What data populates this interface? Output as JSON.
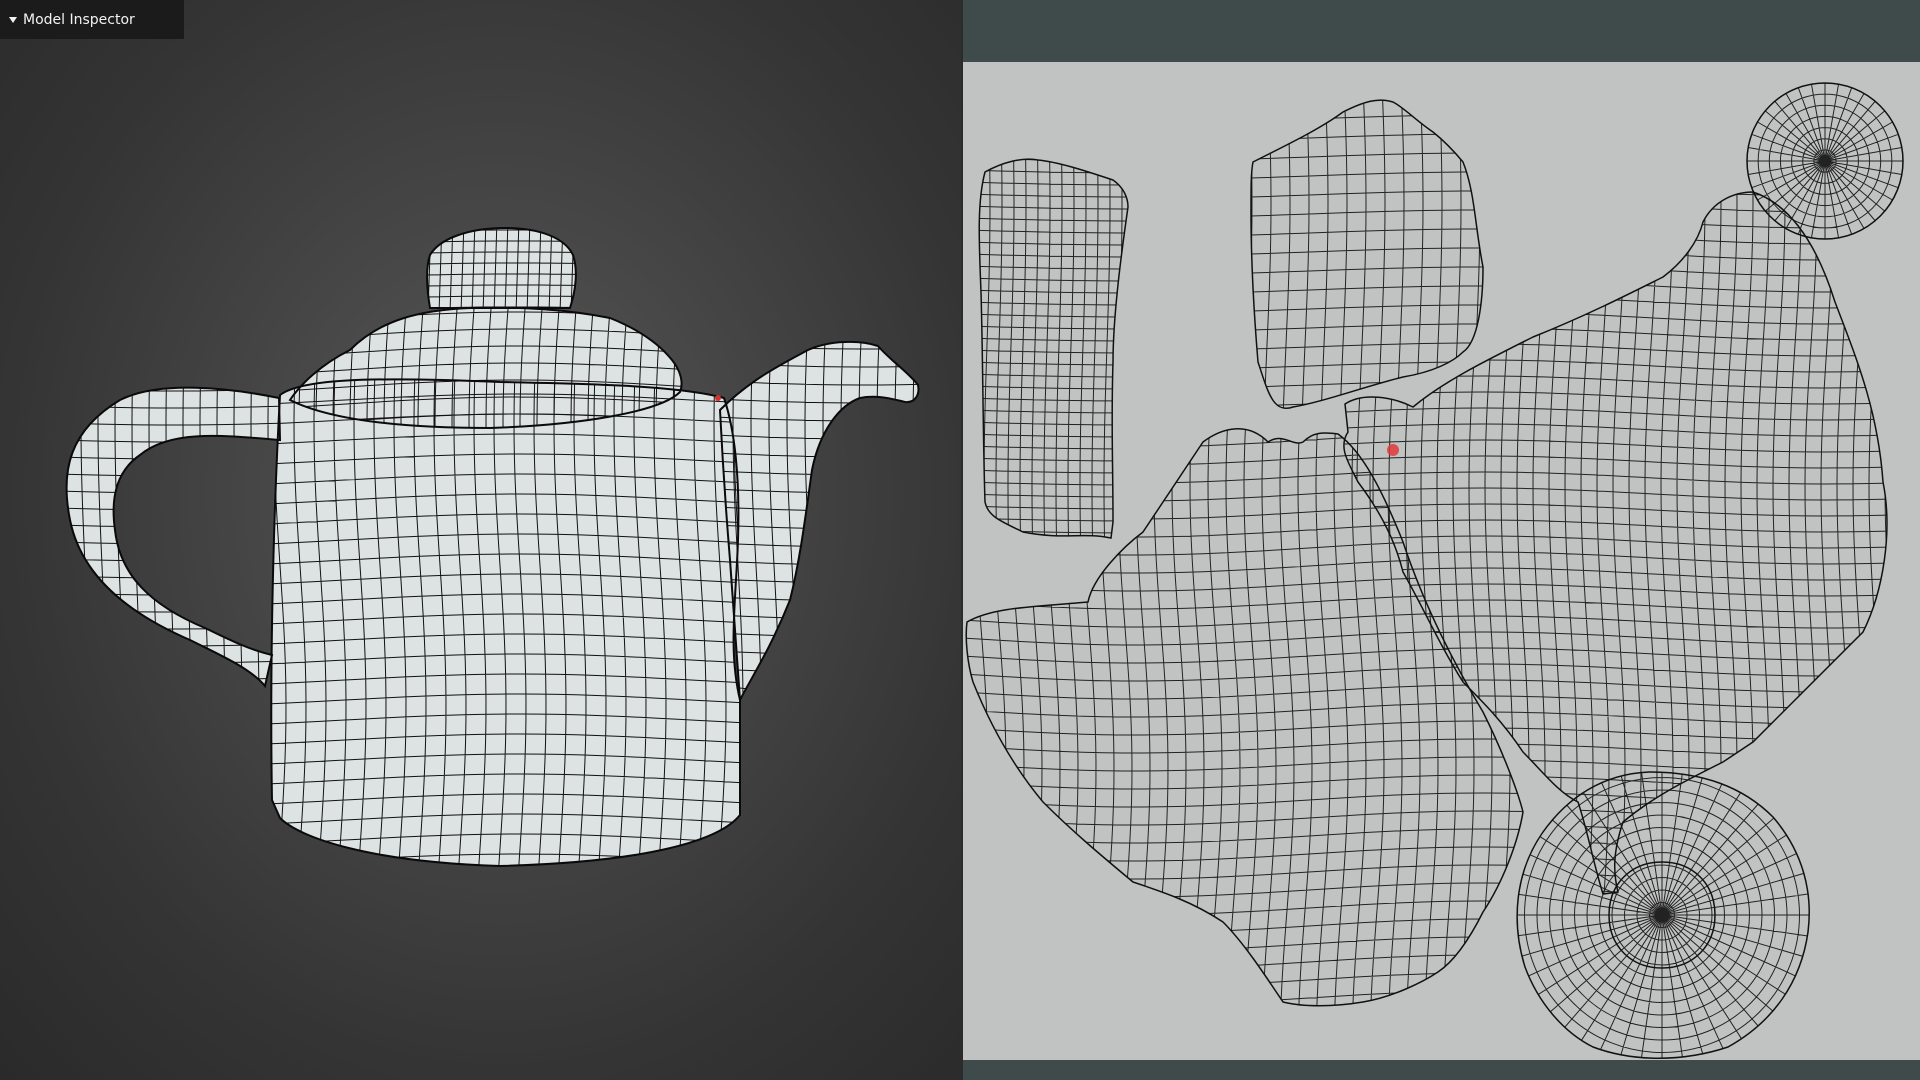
{
  "inspector": {
    "title": "Model Inspector",
    "collapse_icon": "triangle-down-icon"
  },
  "viewport3d": {
    "model": "teapot",
    "background_color": "#3b3b3b",
    "mesh_fill_color": "#dde2e2",
    "wire_color": "#111111",
    "highlight_color": "#d43030"
  },
  "uv_editor": {
    "panel_color": "#3f4a4a",
    "canvas_color": "#c1c3c2",
    "wire_color": "#222222",
    "selected_vertex_color": "#e03a3a",
    "islands": [
      "handle",
      "spout-base",
      "lid-knob-top",
      "spout",
      "body-front",
      "base-ring"
    ]
  }
}
